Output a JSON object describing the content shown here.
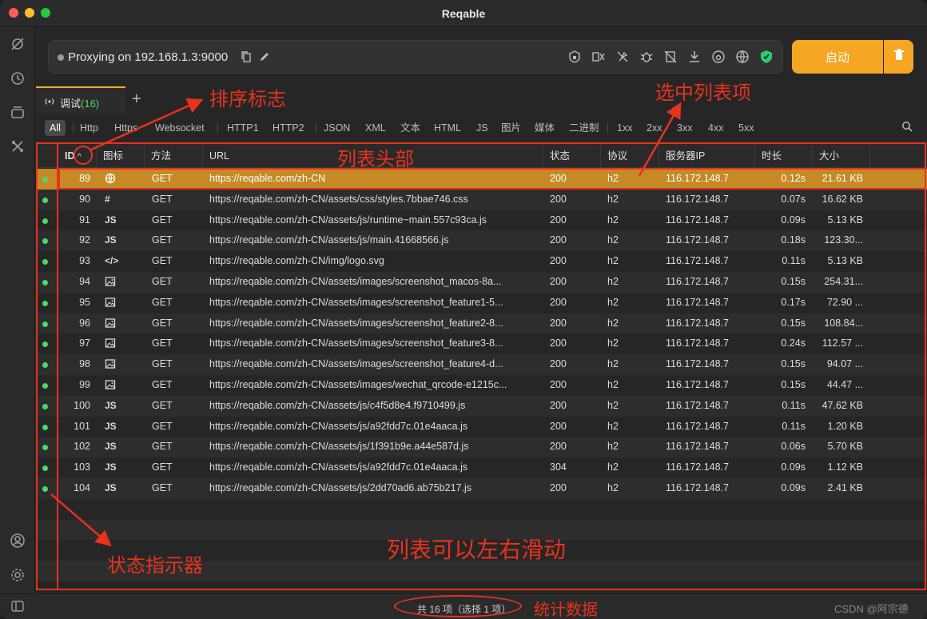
{
  "window": {
    "title": "Reqable"
  },
  "proxy": {
    "status_text": "Proxying on 192.168.1.3:9000",
    "start_label": "启动",
    "accent_color": "#f5a623"
  },
  "tabs": [
    {
      "label": "调试",
      "count": "(16)"
    }
  ],
  "filters": [
    "All",
    "Http",
    "Https",
    "Websocket",
    "HTTP1",
    "HTTP2",
    "JSON",
    "XML",
    "文本",
    "HTML",
    "JS",
    "图片",
    "媒体",
    "二进制",
    "1xx",
    "2xx",
    "3xx",
    "4xx",
    "5xx"
  ],
  "table": {
    "headers": {
      "id": "ID",
      "icon": "图标",
      "method": "方法",
      "url": "URL",
      "status": "状态",
      "protocol": "协议",
      "server_ip": "服务器IP",
      "duration": "时长",
      "size": "大小"
    },
    "rows": [
      {
        "id": "89",
        "icon": "globe-icon",
        "method": "GET",
        "url": "https://reqable.com/zh-CN",
        "status": "200",
        "protocol": "h2",
        "ip": "116.172.148.7",
        "duration": "0.12s",
        "size": "21.61 KB"
      },
      {
        "id": "90",
        "icon": "#",
        "method": "GET",
        "url": "https://reqable.com/zh-CN/assets/css/styles.7bbae746.css",
        "status": "200",
        "protocol": "h2",
        "ip": "116.172.148.7",
        "duration": "0.07s",
        "size": "16.62 KB"
      },
      {
        "id": "91",
        "icon": "JS",
        "method": "GET",
        "url": "https://reqable.com/zh-CN/assets/js/runtime~main.557c93ca.js",
        "status": "200",
        "protocol": "h2",
        "ip": "116.172.148.7",
        "duration": "0.09s",
        "size": "5.13 KB"
      },
      {
        "id": "92",
        "icon": "JS",
        "method": "GET",
        "url": "https://reqable.com/zh-CN/assets/js/main.41668566.js",
        "status": "200",
        "protocol": "h2",
        "ip": "116.172.148.7",
        "duration": "0.18s",
        "size": "123.30..."
      },
      {
        "id": "93",
        "icon": "</>",
        "method": "GET",
        "url": "https://reqable.com/zh-CN/img/logo.svg",
        "status": "200",
        "protocol": "h2",
        "ip": "116.172.148.7",
        "duration": "0.11s",
        "size": "5.13 KB"
      },
      {
        "id": "94",
        "icon": "image-icon",
        "method": "GET",
        "url": "https://reqable.com/zh-CN/assets/images/screenshot_macos-8a...",
        "status": "200",
        "protocol": "h2",
        "ip": "116.172.148.7",
        "duration": "0.15s",
        "size": "254.31..."
      },
      {
        "id": "95",
        "icon": "image-icon",
        "method": "GET",
        "url": "https://reqable.com/zh-CN/assets/images/screenshot_feature1-5...",
        "status": "200",
        "protocol": "h2",
        "ip": "116.172.148.7",
        "duration": "0.17s",
        "size": "72.90 ..."
      },
      {
        "id": "96",
        "icon": "image-icon",
        "method": "GET",
        "url": "https://reqable.com/zh-CN/assets/images/screenshot_feature2-8...",
        "status": "200",
        "protocol": "h2",
        "ip": "116.172.148.7",
        "duration": "0.15s",
        "size": "108.84..."
      },
      {
        "id": "97",
        "icon": "image-icon",
        "method": "GET",
        "url": "https://reqable.com/zh-CN/assets/images/screenshot_feature3-8...",
        "status": "200",
        "protocol": "h2",
        "ip": "116.172.148.7",
        "duration": "0.24s",
        "size": "112.57 ..."
      },
      {
        "id": "98",
        "icon": "image-icon",
        "method": "GET",
        "url": "https://reqable.com/zh-CN/assets/images/screenshot_feature4-d...",
        "status": "200",
        "protocol": "h2",
        "ip": "116.172.148.7",
        "duration": "0.15s",
        "size": "94.07 ..."
      },
      {
        "id": "99",
        "icon": "image-icon",
        "method": "GET",
        "url": "https://reqable.com/zh-CN/assets/images/wechat_qrcode-e1215c...",
        "status": "200",
        "protocol": "h2",
        "ip": "116.172.148.7",
        "duration": "0.15s",
        "size": "44.47 ..."
      },
      {
        "id": "100",
        "icon": "JS",
        "method": "GET",
        "url": "https://reqable.com/zh-CN/assets/js/c4f5d8e4.f9710499.js",
        "status": "200",
        "protocol": "h2",
        "ip": "116.172.148.7",
        "duration": "0.11s",
        "size": "47.62 KB"
      },
      {
        "id": "101",
        "icon": "JS",
        "method": "GET",
        "url": "https://reqable.com/zh-CN/assets/js/a92fdd7c.01e4aaca.js",
        "status": "200",
        "protocol": "h2",
        "ip": "116.172.148.7",
        "duration": "0.11s",
        "size": "1.20 KB"
      },
      {
        "id": "102",
        "icon": "JS",
        "method": "GET",
        "url": "https://reqable.com/zh-CN/assets/js/1f391b9e.a44e587d.js",
        "status": "200",
        "protocol": "h2",
        "ip": "116.172.148.7",
        "duration": "0.06s",
        "size": "5.70 KB"
      },
      {
        "id": "103",
        "icon": "JS",
        "method": "GET",
        "url": "https://reqable.com/zh-CN/assets/js/a92fdd7c.01e4aaca.js",
        "status": "304",
        "protocol": "h2",
        "ip": "116.172.148.7",
        "duration": "0.09s",
        "size": "1.12 KB"
      },
      {
        "id": "104",
        "icon": "JS",
        "method": "GET",
        "url": "https://reqable.com/zh-CN/assets/js/2dd70ad6.ab75b217.js",
        "status": "200",
        "protocol": "h2",
        "ip": "116.172.148.7",
        "duration": "0.09s",
        "size": "2.41 KB"
      }
    ]
  },
  "statusbar": {
    "summary": "共 16 项（选择 1 项）",
    "watermark": "CSDN @阿宗德"
  },
  "annotations": {
    "sort_flag": "排序标志",
    "selected_item": "选中列表项",
    "list_header": "列表头部",
    "status_indicator": "状态指示器",
    "scroll_hint": "列表可以左右滑动",
    "stats": "统计数据",
    "color": "#e8321f"
  }
}
